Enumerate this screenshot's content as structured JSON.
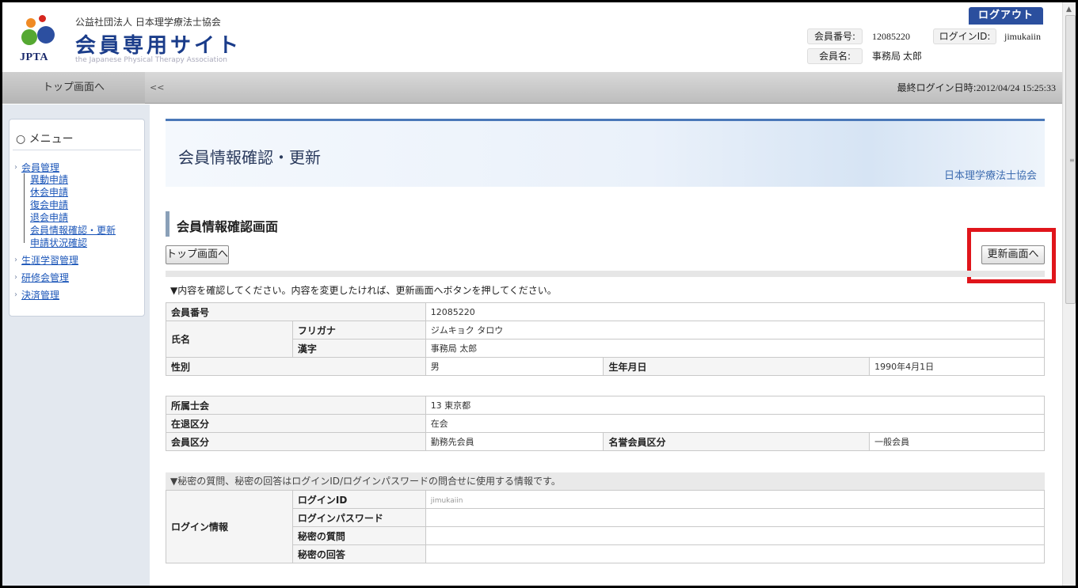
{
  "header": {
    "org_name": "公益社団法人 日本理学療法士協会",
    "site_title": "会員専用サイト",
    "org_english": "the Japanese Physical Therapy Association",
    "logo_text": "JPTA",
    "logout_label": "ログアウト",
    "member_no_label": "会員番号:",
    "member_no_value": "12085220",
    "login_id_label": "ログインID:",
    "login_id_value": "jimukaiin",
    "member_name_label": "会員名:",
    "member_name_value": "事務局 太郎"
  },
  "nav": {
    "top_link": "トップ画面へ",
    "collapse": "<<",
    "last_login_label": "最終ログイン日時:",
    "last_login_value": "2012/04/24 15:25:33"
  },
  "sidebar": {
    "menu_title": "○ メニュー",
    "items": [
      {
        "label": "会員管理"
      },
      {
        "label": "異動申請"
      },
      {
        "label": "休会申請"
      },
      {
        "label": "復会申請"
      },
      {
        "label": "退会申請"
      },
      {
        "label": "会員情報確認・更新"
      },
      {
        "label": "申請状況確認"
      },
      {
        "label": "生涯学習管理"
      },
      {
        "label": "研修会管理"
      },
      {
        "label": "決済管理"
      }
    ]
  },
  "main": {
    "banner_title": "会員情報確認・更新",
    "banner_org": "日本理学療法士協会",
    "section_title": "会員情報確認画面",
    "top_button": "トップ画面へ",
    "update_button": "更新画面へ",
    "instruction": "▼内容を確認してください。内容を変更したければ、更新画面へボタンを押してください。",
    "basic": {
      "member_no_label": "会員番号",
      "member_no_value": "12085220",
      "name_label": "氏名",
      "furigana_label": "フリガナ",
      "furigana_value": "ジムキョク タロウ",
      "kanji_label": "漢字",
      "kanji_value": "事務局 太郎",
      "gender_label": "性別",
      "gender_value": "男",
      "birth_label": "生年月日",
      "birth_value": "1990年4月1日"
    },
    "affiliation": {
      "branch_label": "所属士会",
      "branch_value": "13 東京都",
      "status_label": "在退区分",
      "status_value": "在会",
      "member_type_label": "会員区分",
      "member_type_value": "勤務先会員",
      "honorary_label": "名誉会員区分",
      "honorary_value": "一般会員"
    },
    "secret_note": "▼秘密の質問、秘密の回答はログインID/ログインパスワードの問合せに使用する情報です。",
    "login": {
      "group_label": "ログイン情報",
      "id_label": "ログインID",
      "id_value": "jimukaiin",
      "password_label": "ログインパスワード",
      "question_label": "秘密の質問",
      "answer_label": "秘密の回答"
    }
  },
  "colors": {
    "accent_blue": "#2b4f9e",
    "highlight_red": "#e0151b",
    "link_blue": "#1a55b8"
  }
}
